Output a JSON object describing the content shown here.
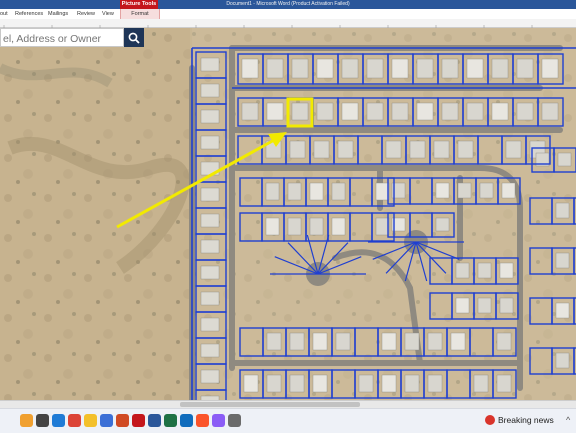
{
  "window": {
    "title": "Document1 - Microsoft Word (Product Activation Failed)"
  },
  "ribbon": {
    "tabs": [
      "out",
      "References",
      "Mailings",
      "Review",
      "View"
    ],
    "contextual_group": "Picture Tools",
    "contextual_tab": "Format"
  },
  "search": {
    "placeholder": "el, Address or Owner"
  },
  "map": {
    "parcel_line_color": "#1f3fd1",
    "highlight_color": "#f2ea00",
    "arrow_color": "#f2ea00"
  },
  "taskbar": {
    "news_label": "Breaking news",
    "icons": [
      "copilot-icon",
      "search-icon",
      "edge-icon",
      "chrome-icon",
      "file-explorer-icon",
      "store-icon",
      "powerpoint-icon",
      "acrobat-icon",
      "word-icon",
      "excel-icon",
      "outlook-icon",
      "brave-icon",
      "snip-icon",
      "settings-icon"
    ]
  }
}
